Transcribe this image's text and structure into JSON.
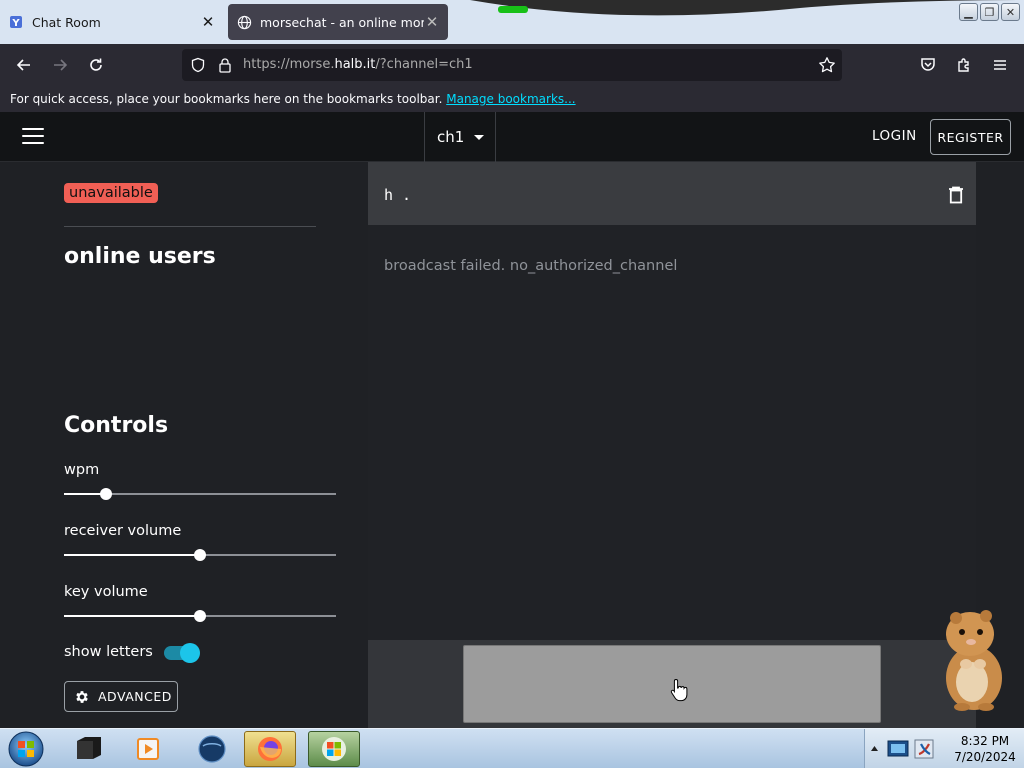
{
  "browser": {
    "tabs": [
      {
        "title": "Chat Room",
        "active": false,
        "icon": "chatroom-favicon"
      },
      {
        "title": "morsechat - an online morse c",
        "active": true,
        "icon": "globe-icon"
      }
    ],
    "url_full": "https://morse.halb.it/?channel=ch1",
    "url_prefix": "https://morse.",
    "url_domain": "halb.it",
    "url_suffix": "/?channel=ch1",
    "bookmarks_text": "For quick access, place your bookmarks here on the bookmarks toolbar.",
    "bookmarks_link": "Manage bookmarks..."
  },
  "app": {
    "channel": "ch1",
    "login_label": "LOGIN",
    "register_label": "REGISTER",
    "status_badge": "unavailable",
    "online_users_heading": "online users",
    "controls_heading": "Controls",
    "controls": {
      "wpm": {
        "label": "wpm",
        "value": 0.155
      },
      "receiver_volume": {
        "label": "receiver volume",
        "value": 0.5
      },
      "key_volume": {
        "label": "key volume",
        "value": 0.5
      }
    },
    "show_letters_label": "show letters",
    "show_letters_on": true,
    "advanced_label": "ADVANCED",
    "message_input": "h .",
    "broadcast_message": "broadcast failed. no_authorized_channel"
  },
  "taskbar": {
    "time": "8:32 PM",
    "date": "7/20/2024"
  },
  "colors": {
    "badge": "#f15f55",
    "toggle_accent": "#1cc5ea",
    "link": "#00ddff"
  }
}
